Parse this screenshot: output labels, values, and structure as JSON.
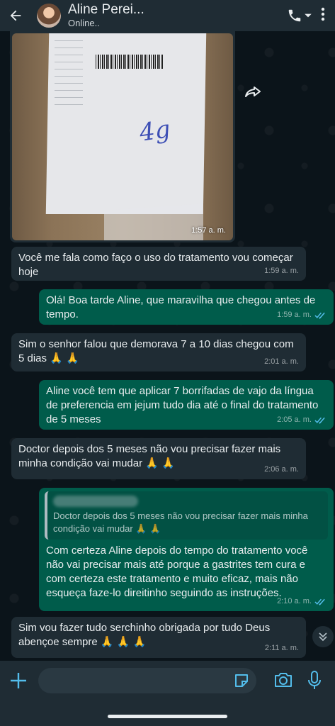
{
  "header": {
    "back_icon": "arrow-left-icon",
    "contact_name": "Aline Perei...",
    "contact_status": "Online..",
    "call_icon": "phone-icon",
    "menu_icon": "chevron-down-icon"
  },
  "messages": [
    {
      "type": "image",
      "direction": "in",
      "time": "1:57 a. m.",
      "handwriting": "4g"
    },
    {
      "type": "text",
      "direction": "in",
      "text": "Você me fala como faço o uso do tratamento vou começar hoje",
      "time": "1:59 a. m."
    },
    {
      "type": "text",
      "direction": "out",
      "text": "Olá! Boa tarde Aline, que maravilha que chegou antes de tempo.",
      "time": "1:59 a. m."
    },
    {
      "type": "text",
      "direction": "in",
      "text": "Sim o senhor falou  que demorava  7 a 10 dias chegou com 5 dias 🙏 🙏",
      "time": "2:01 a. m."
    },
    {
      "type": "text",
      "direction": "out",
      "text": "Aline você tem que aplicar 7 borrifadas de vajo  da língua de preferencia em jejum tudo dia até o final do tratamento de 5 meses",
      "time": "2:05 a. m."
    },
    {
      "type": "text",
      "direction": "in",
      "text": "Doctor depois dos 5 meses não vou precisar fazer mais minha condição vai mudar 🙏 🙏",
      "time": "2:06 a. m."
    },
    {
      "type": "reply",
      "direction": "out",
      "quote": "Doctor depois dos 5 meses não vou precisar fazer mais minha condição vai mudar 🙏 🙏",
      "text": "Com certeza Aline depois do tempo do tratamento você não vai precisar mais até porque a gastrites tem cura e com certeza este tratamento e muito eficaz, mais não esqueça faze-lo direitinho seguindo as instruções.",
      "time": "2:10 a. m."
    },
    {
      "type": "text",
      "direction": "in",
      "text": "Sim vou fazer tudo serchinho obrigada por tudo Deus abençoe sempre 🙏 🙏 🙏",
      "time": "2:11 a. m."
    }
  ],
  "input": {
    "placeholder": "",
    "value": ""
  },
  "colors": {
    "header": "#1f2c34",
    "incoming": "#1f2c34",
    "outgoing": "#005c4b",
    "read_ticks": "#53bdeb",
    "accent": "#00a884"
  }
}
